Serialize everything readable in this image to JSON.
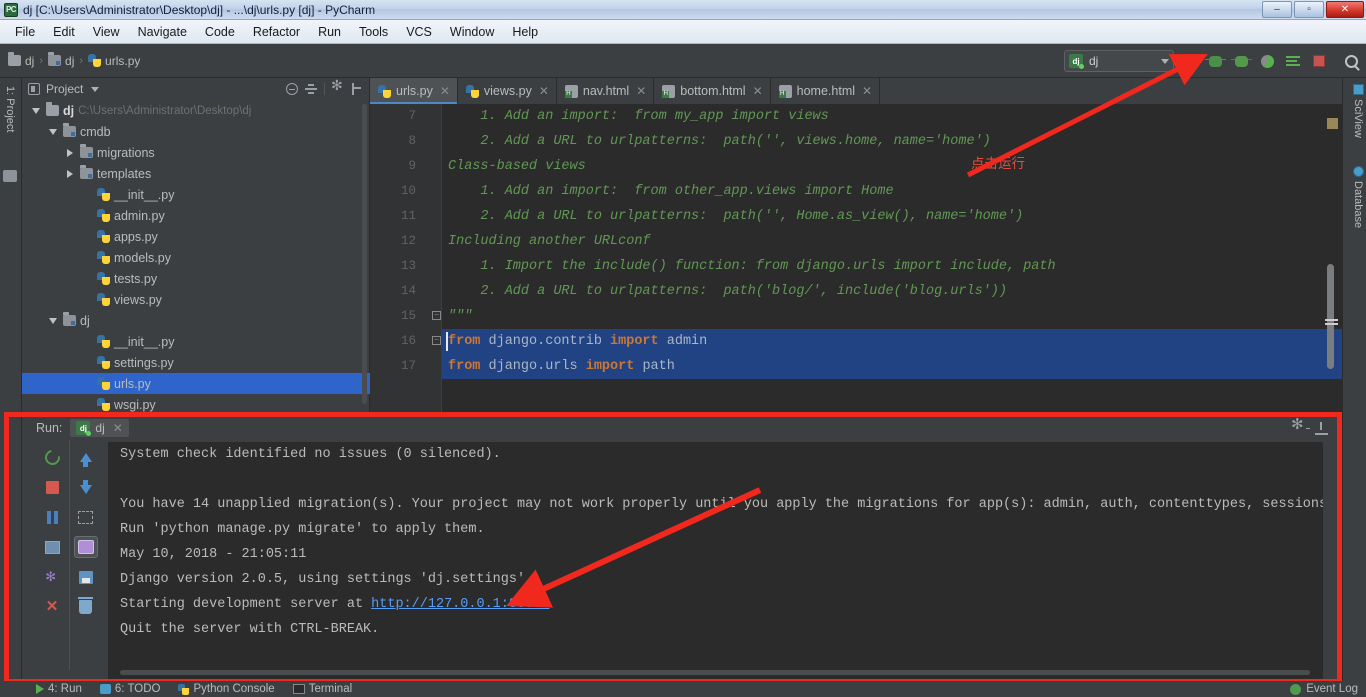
{
  "window": {
    "title": "dj [C:\\Users\\Administrator\\Desktop\\dj] - ...\\dj\\urls.py [dj] - PyCharm",
    "app_icon": "pycharm-icon",
    "minimize": "–",
    "maximize": "▫",
    "close": "✕"
  },
  "menubar": {
    "items": [
      "File",
      "Edit",
      "View",
      "Navigate",
      "Code",
      "Refactor",
      "Run",
      "Tools",
      "VCS",
      "Window",
      "Help"
    ]
  },
  "breadcrumb": {
    "items": [
      {
        "label": "dj",
        "icon": "folder-icon"
      },
      {
        "label": "dj",
        "icon": "module-folder-icon"
      },
      {
        "label": "urls.py",
        "icon": "python-file-icon"
      }
    ]
  },
  "toolbar_right": {
    "run_config": "dj",
    "buttons": [
      {
        "name": "run-button",
        "icon": "run-triangle-icon"
      },
      {
        "name": "debug-button",
        "icon": "debug-bug-icon"
      },
      {
        "name": "run-coverage-button",
        "icon": "coverage-icon"
      },
      {
        "name": "profile-button",
        "icon": "profile-icon"
      },
      {
        "name": "attach-button",
        "icon": "attach-icon"
      },
      {
        "name": "stop-button",
        "icon": "stop-square-icon"
      },
      {
        "name": "search-everywhere-button",
        "icon": "search-icon"
      }
    ]
  },
  "left_strip": {
    "project_tab": "1: Project",
    "structure_tab": "structure-icon"
  },
  "right_strip": {
    "tabs": [
      "SciView",
      "Database"
    ]
  },
  "project_panel": {
    "title": "Project",
    "tools": [
      "collapse-all-icon",
      "expand-icon",
      "settings-gear-icon",
      "hide-icon"
    ],
    "tree": [
      {
        "label": "dj",
        "path": "C:\\Users\\Administrator\\Desktop\\dj",
        "indent": 0,
        "twisty": "down",
        "icon": "folder-icon",
        "bold": true
      },
      {
        "label": "cmdb",
        "indent": 1,
        "twisty": "down",
        "icon": "module-folder-icon"
      },
      {
        "label": "migrations",
        "indent": 2,
        "twisty": "right",
        "icon": "module-folder-icon"
      },
      {
        "label": "templates",
        "indent": 2,
        "twisty": "right",
        "icon": "module-folder-icon"
      },
      {
        "label": "__init__.py",
        "indent": 3,
        "twisty": "none",
        "icon": "python-file-icon"
      },
      {
        "label": "admin.py",
        "indent": 3,
        "twisty": "none",
        "icon": "python-file-icon"
      },
      {
        "label": "apps.py",
        "indent": 3,
        "twisty": "none",
        "icon": "python-file-icon"
      },
      {
        "label": "models.py",
        "indent": 3,
        "twisty": "none",
        "icon": "python-file-icon"
      },
      {
        "label": "tests.py",
        "indent": 3,
        "twisty": "none",
        "icon": "python-file-icon"
      },
      {
        "label": "views.py",
        "indent": 3,
        "twisty": "none",
        "icon": "python-file-icon"
      },
      {
        "label": "dj",
        "indent": 1,
        "twisty": "down",
        "icon": "module-folder-icon"
      },
      {
        "label": "__init__.py",
        "indent": 3,
        "twisty": "none",
        "icon": "python-file-icon"
      },
      {
        "label": "settings.py",
        "indent": 3,
        "twisty": "none",
        "icon": "python-file-icon"
      },
      {
        "label": "urls.py",
        "indent": 3,
        "twisty": "none",
        "icon": "python-file-icon",
        "selected": true
      },
      {
        "label": "wsgi.py",
        "indent": 3,
        "twisty": "none",
        "icon": "python-file-icon"
      }
    ]
  },
  "editor": {
    "tabs": [
      {
        "label": "urls.py",
        "icon": "python-file-icon",
        "active": true
      },
      {
        "label": "views.py",
        "icon": "python-file-icon",
        "active": false
      },
      {
        "label": "nav.html",
        "icon": "html-file-icon",
        "active": false
      },
      {
        "label": "bottom.html",
        "icon": "html-file-icon",
        "active": false
      },
      {
        "label": "home.html",
        "icon": "html-file-icon",
        "active": false
      }
    ],
    "close_glyph": "✕",
    "lines": [
      {
        "no": "7",
        "text": "    1. Add an import:  from my_app import views",
        "style": "doc"
      },
      {
        "no": "8",
        "text": "    2. Add a URL to urlpatterns:  path('', views.home, name='home')",
        "style": "doc"
      },
      {
        "no": "9",
        "text": "Class-based views",
        "style": "doc"
      },
      {
        "no": "10",
        "text": "    1. Add an import:  from other_app.views import Home",
        "style": "doc"
      },
      {
        "no": "11",
        "text": "    2. Add a URL to urlpatterns:  path('', Home.as_view(), name='home')",
        "style": "doc"
      },
      {
        "no": "12",
        "text": "Including another URLconf",
        "style": "doc"
      },
      {
        "no": "13",
        "text": "    1. Import the include() function: from django.urls import include, path",
        "style": "doc"
      },
      {
        "no": "14",
        "text": "    2. Add a URL to urlpatterns:  path('blog/', include('blog.urls'))",
        "style": "doc"
      },
      {
        "no": "15",
        "text": "\"\"\"",
        "style": "doc"
      },
      {
        "no": "16",
        "text": "from django.contrib import admin",
        "style": "code",
        "selected": true
      },
      {
        "no": "17",
        "text": "from django.urls import path",
        "style": "code",
        "selected": true
      }
    ]
  },
  "annotations": {
    "run_hint": "点击运行"
  },
  "run_window": {
    "label": "Run:",
    "tab_name": "dj",
    "tab_icon": "run-config-icon",
    "close_glyph": "✕",
    "header_tools": [
      "settings-gear-icon",
      "hide-window-icon"
    ],
    "side_buttons_left": [
      "rerun-icon",
      "stop-icon",
      "pause-icon",
      "grid-icon",
      "pin-icon",
      "close-icon"
    ],
    "side_buttons_right": [
      "scroll-up-icon",
      "scroll-down-icon",
      "soft-wrap-icon",
      "print-icon",
      "clear-all-icon"
    ],
    "console": [
      {
        "text": "System check identified no issues (0 silenced)."
      },
      {
        "text": ""
      },
      {
        "text": "You have 14 unapplied migration(s). Your project may not work properly until you apply the migrations for app(s): admin, auth, contenttypes, sessions."
      },
      {
        "text": "Run 'python manage.py migrate' to apply them."
      },
      {
        "text": "May 10, 2018 - 21:05:11"
      },
      {
        "text": "Django version 2.0.5, using settings 'dj.settings'"
      },
      {
        "text": "Starting development server at ",
        "link": "http://127.0.0.1:8001/"
      },
      {
        "text": "Quit the server with CTRL-BREAK."
      }
    ]
  },
  "statusbar": {
    "items": [
      {
        "label": "4: Run",
        "icon": "run-icon"
      },
      {
        "label": "6: TODO",
        "icon": "todo-icon"
      },
      {
        "label": "Python Console",
        "icon": "python-console-icon"
      },
      {
        "label": "Terminal",
        "icon": "terminal-icon"
      }
    ],
    "event_log": "Event Log"
  },
  "colors": {
    "accent_red": "#f0281e",
    "selection_blue": "#214283",
    "tree_selection": "#2f65ca",
    "link_blue": "#589df6",
    "doc_green": "#629755",
    "keyword_orange": "#cc7832"
  }
}
